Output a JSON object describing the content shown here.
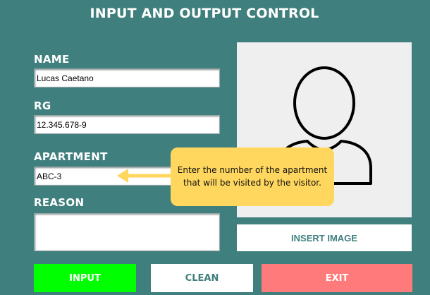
{
  "header": {
    "title": "INPUT AND OUTPUT CONTROL"
  },
  "form": {
    "name": {
      "label": "NAME",
      "value": "Lucas Caetano"
    },
    "rg": {
      "label": "RG",
      "value": "12.345.678-9"
    },
    "apartment": {
      "label": "APARTMENT",
      "value": "ABC-3"
    },
    "reason": {
      "label": "REASON",
      "value": ""
    }
  },
  "photo": {
    "icon": "user-silhouette-icon",
    "insert_label": "INSERT IMAGE"
  },
  "tooltip": {
    "line1": "Enter the number of the apartment",
    "line2": "that will be visited by the visitor.",
    "color": "#ffd75e"
  },
  "buttons": {
    "input_label": "INPUT",
    "clean_label": "CLEAN",
    "exit_label": "EXIT"
  },
  "colors": {
    "background": "#3f7f7d",
    "input": "#00ff00",
    "exit": "#ff7b7b"
  }
}
